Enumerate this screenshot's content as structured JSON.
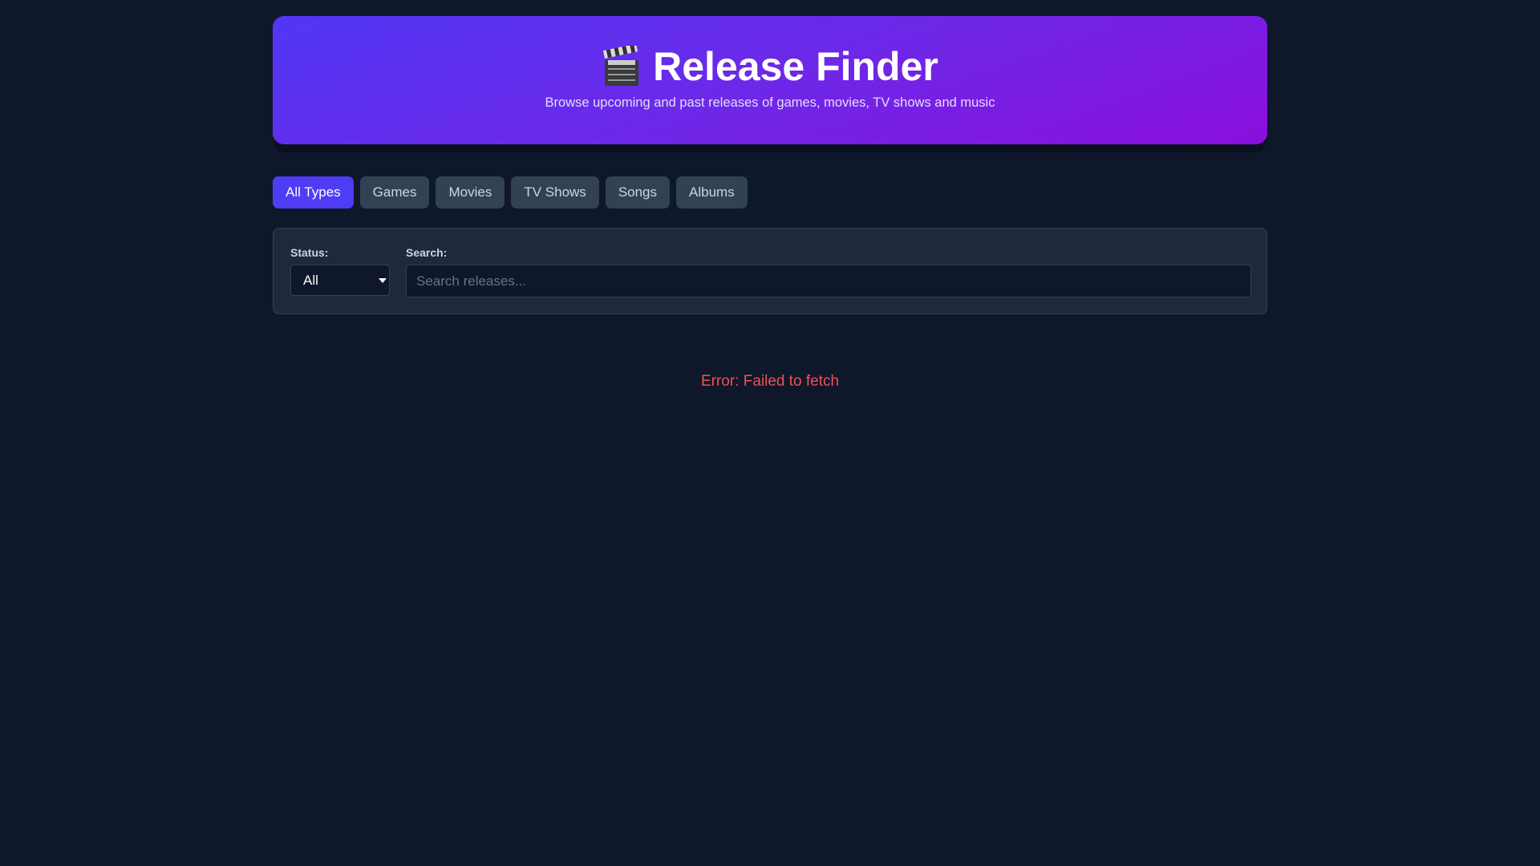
{
  "header": {
    "title": "Release Finder",
    "subtitle": "Browse upcoming and past releases of games, movies, TV shows and music",
    "icon": "clapperboard-icon"
  },
  "tabs": [
    {
      "label": "All Types",
      "active": true
    },
    {
      "label": "Games"
    },
    {
      "label": "Movies"
    },
    {
      "label": "TV Shows"
    },
    {
      "label": "Songs"
    },
    {
      "label": "Albums"
    }
  ],
  "filters": {
    "status_label": "Status:",
    "status_value": "All",
    "search_label": "Search:",
    "search_placeholder": "Search releases...",
    "search_value": ""
  },
  "error": "Error: Failed to fetch",
  "colors": {
    "accent": "#4f3cf5",
    "background": "#0f172a",
    "error": "#f05252"
  }
}
